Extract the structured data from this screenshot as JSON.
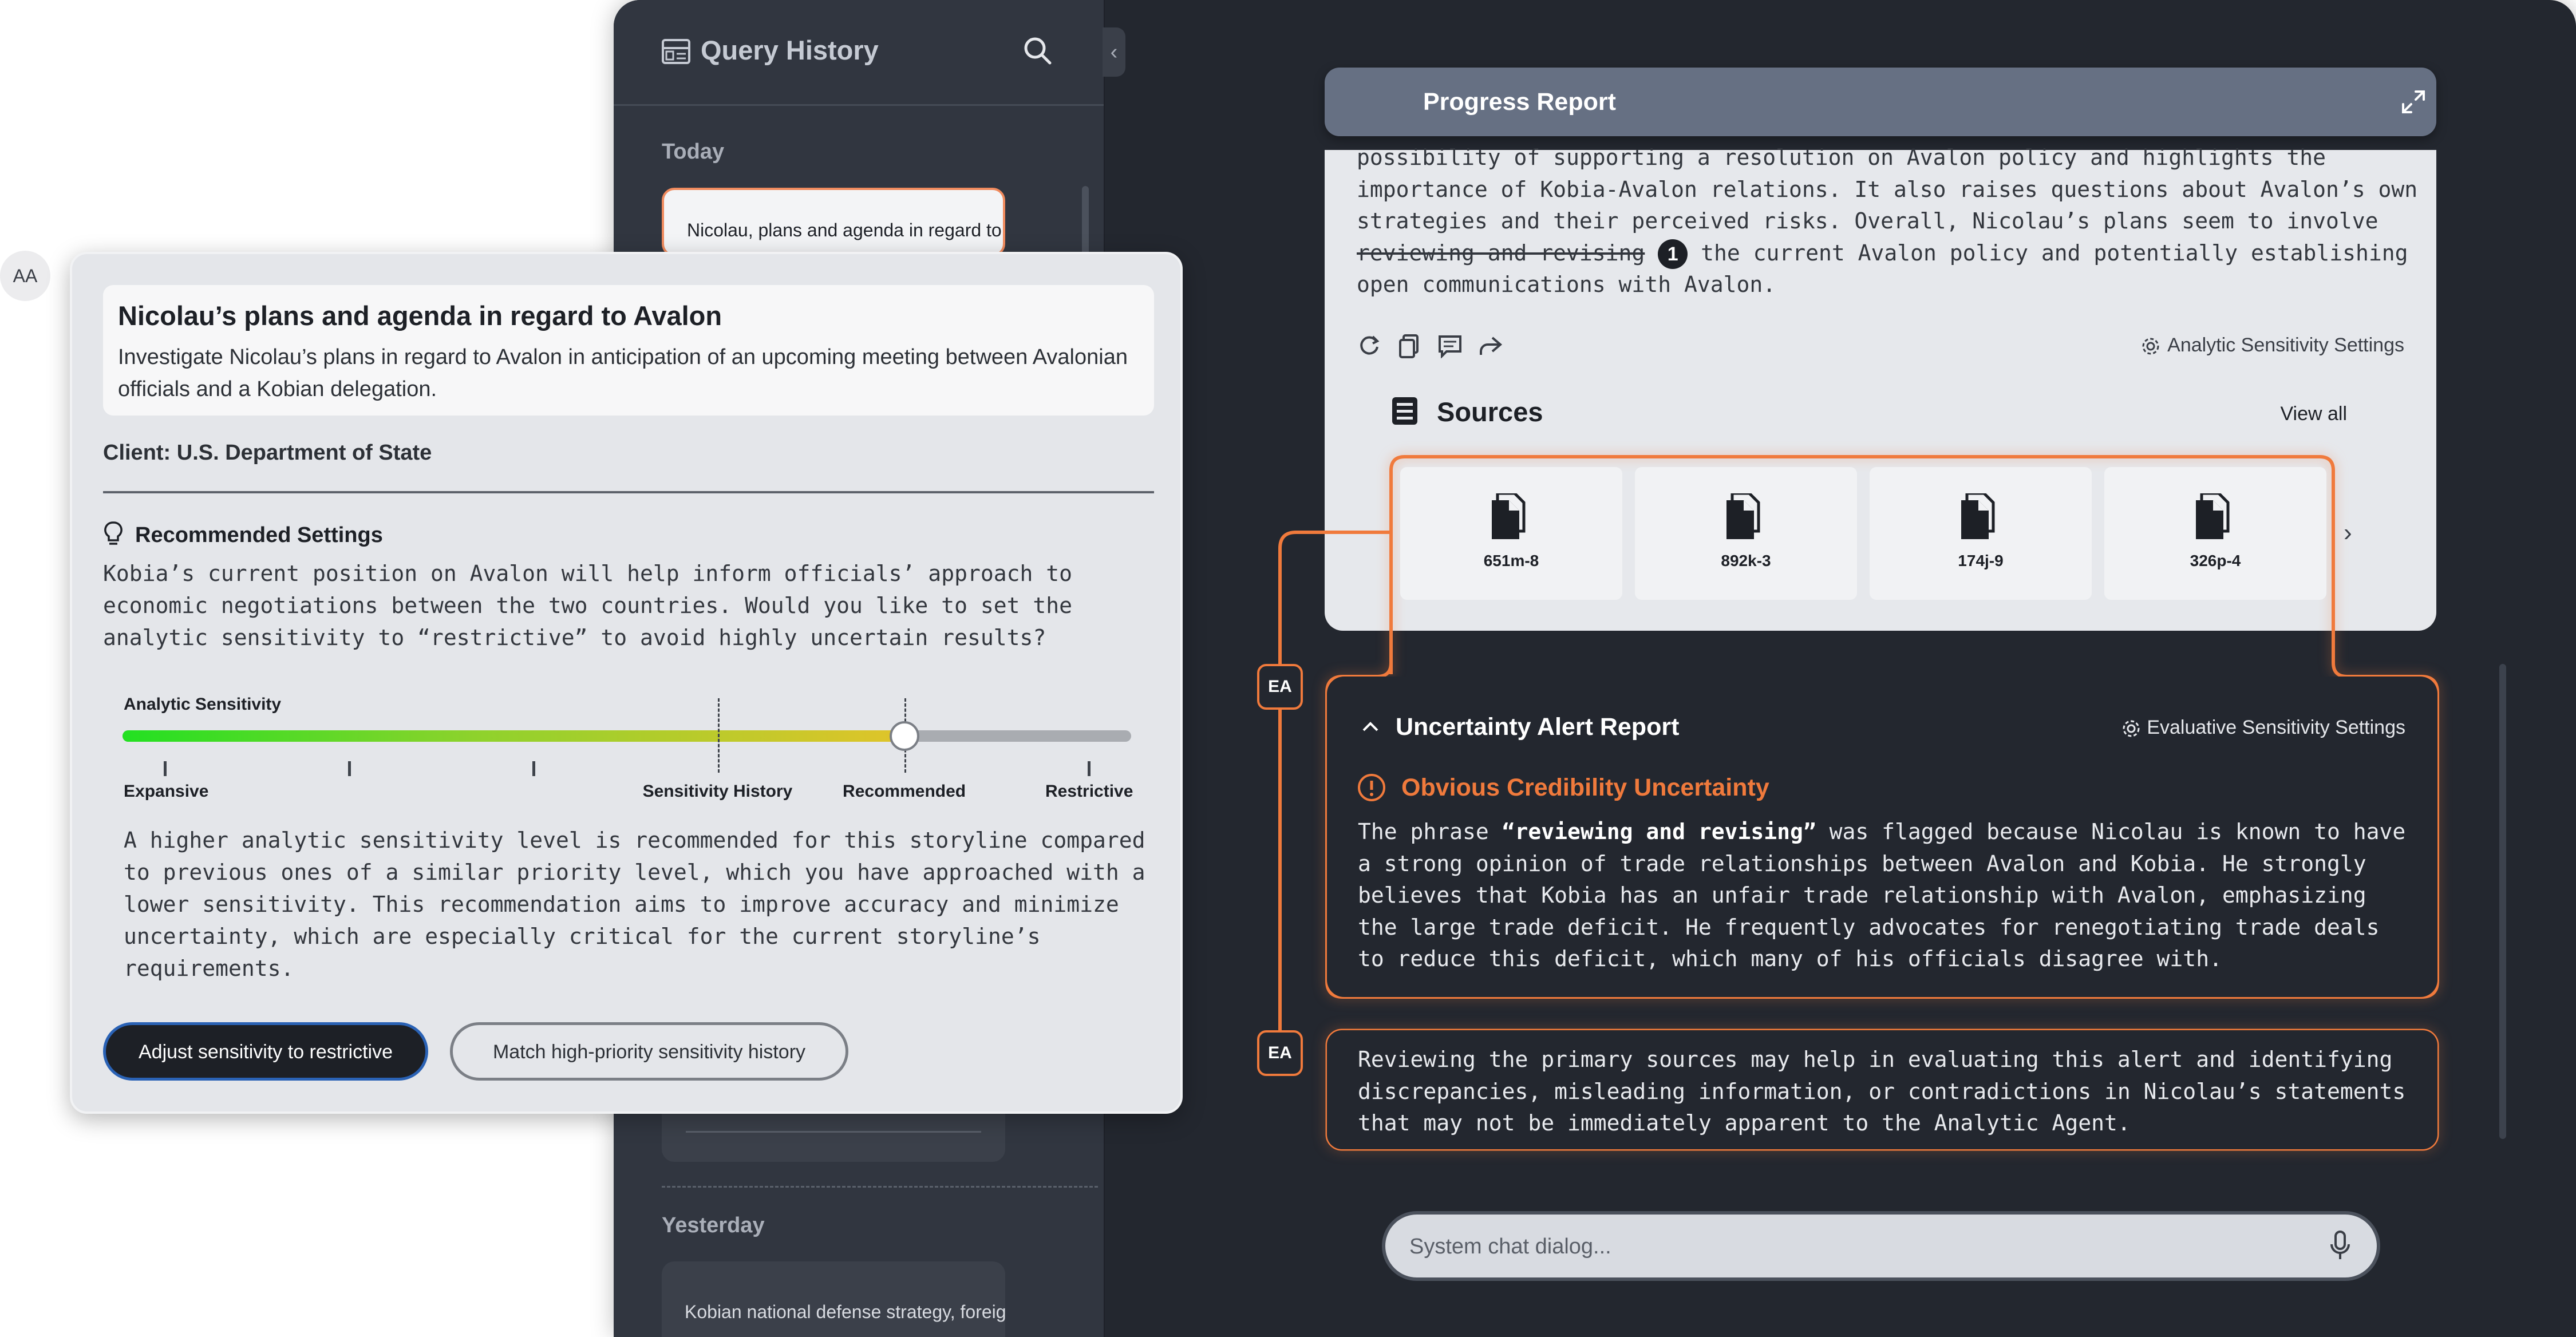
{
  "sidebar": {
    "title": "Query History",
    "sections": [
      "Today",
      "Yesterday"
    ],
    "today_item": "Nicolau, plans and agenda in regard to Avalon",
    "yesterday_item": "Kobian national defense strategy, foreign"
  },
  "progress_report": {
    "title": "Progress Report",
    "lines": [
      "possibility of supporting a resolution on Avalon policy and highlights the",
      "importance of Kobia-Avalon relations. It also raises questions about Avalon’s own",
      "strategies and their perceived risks. Overall, Nicolau’s plans seem to involve"
    ],
    "struck_phrase": "reviewing and revising",
    "marker": "1",
    "line4_rest": " the current Avalon policy and potentially establishing",
    "line5": "open communications with Avalon.",
    "analytic_settings": "Analytic Sensitivity Settings",
    "sources_title": "Sources",
    "view_all": "View all",
    "sources": [
      "651m-8",
      "892k-3",
      "174j-9",
      "326p-4"
    ]
  },
  "alert": {
    "title": "Uncertainty Alert Report",
    "settings": "Evaluative Sensitivity Settings",
    "subtitle": "Obvious Credibility Uncertainty",
    "text_prefix": "The phrase ",
    "phrase": "“reviewing and revising”",
    "text_suffix": " was flagged because Nicolau is known to have a strong opinion of trade relationships between Avalon and Kobia. He strongly believes that Kobia has an unfair trade relationship with Avalon, emphasizing the large trade deficit. He frequently advocates for renegotiating trade deals to reduce this deficit, which many of his officials disagree with.",
    "recommendation": "Reviewing the primary sources may help in evaluating this alert and identifying discrepancies, misleading information, or contradictions in Nicolau’s statements that may not be immediately apparent to the Analytic Agent."
  },
  "agent_badge": "EA",
  "avatar": "AA",
  "chat": {
    "placeholder": "System chat dialog..."
  },
  "card": {
    "title": "Nicolau’s plans and agenda in regard to Avalon",
    "description": "Investigate Nicolau’s plans in regard to Avalon in anticipation of an upcoming meeting between Avalonian officials and a Kobian delegation.",
    "client": "Client: U.S. Department of State",
    "reco_heading": "Recommended Settings",
    "reco_body": "Kobia’s current position on Avalon will help inform officials’ approach to economic negotiations between the two countries. Would you like to set the analytic sensitivity to “restrictive” to avoid highly uncertain results?",
    "slider": {
      "label": "Analytic Sensitivity",
      "value_fraction": 0.775,
      "history_fraction": 0.59,
      "tick_labels": [
        "Expansive",
        "Sensitivity History",
        "Recommended",
        "Restrictive"
      ]
    },
    "explanation": "A higher analytic sensitivity level is recommended for this storyline compared to previous ones of a similar priority level, which you have approached with a lower sensitivity. This recommendation aims to improve accuracy and minimize uncertainty, which are especially critical for the current storyline’s requirements.",
    "button_adjust": "Adjust sensitivity to restrictive",
    "button_match": "Match high-priority sensitivity history"
  },
  "colors": {
    "accent": "#f07a3c",
    "dark": "#23272f",
    "panel": "#e6e8ec"
  }
}
